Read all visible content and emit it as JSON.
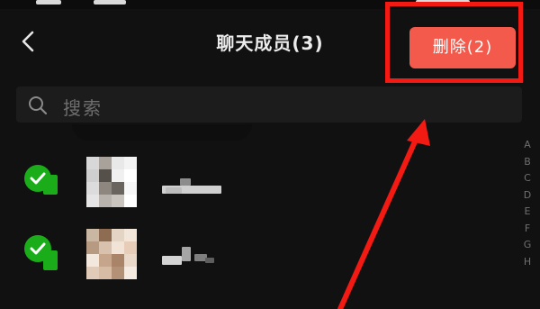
{
  "header": {
    "title": "聊天成员(3)",
    "delete_label": "删除(2)",
    "back_icon": "chevron-left-icon"
  },
  "search": {
    "placeholder": "搜索",
    "icon": "search-icon"
  },
  "members": [
    {
      "selected": true,
      "avatar_label": "pixelated avatar",
      "name_label": "pixelated name"
    },
    {
      "selected": true,
      "avatar_label": "pixelated avatar",
      "name_label": "pixelated name"
    }
  ],
  "index_letters": [
    "A",
    "B",
    "C",
    "D",
    "E",
    "F",
    "G",
    "H"
  ],
  "colors": {
    "background": "#111111",
    "delete_button": "#f45a4c",
    "check_green": "#1aad19",
    "annotation_red": "#f21a12"
  }
}
